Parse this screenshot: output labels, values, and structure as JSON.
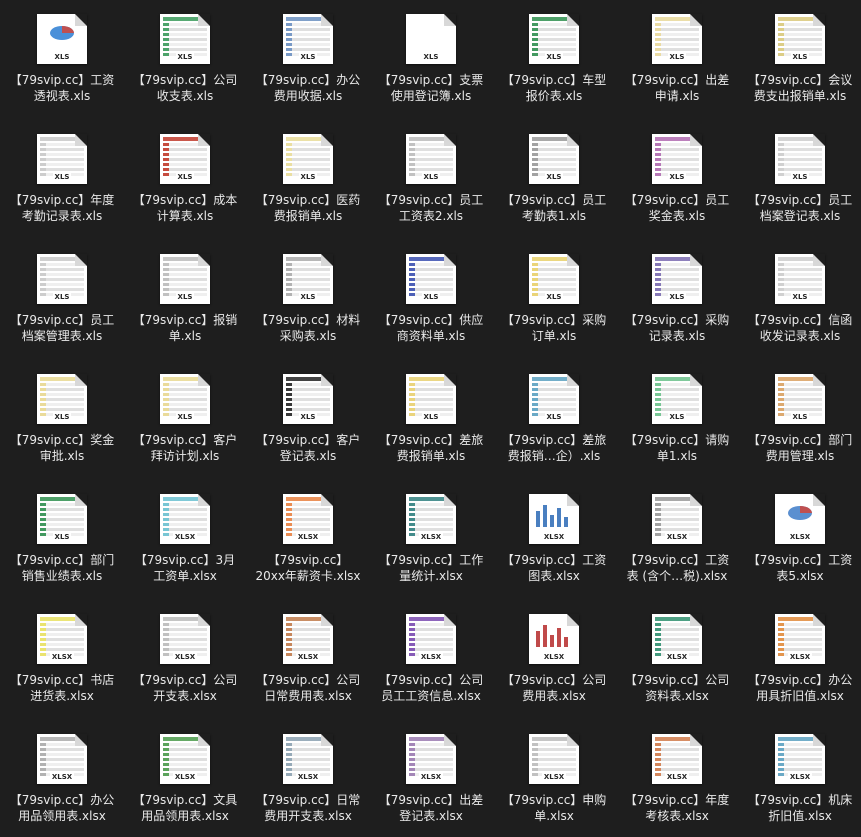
{
  "files": [
    {
      "line1": "【79svip.cc】工资",
      "line2": "透视表.xls",
      "ext": "XLS",
      "icon": "pie-chart-icon",
      "accent": "#4a90d9"
    },
    {
      "line1": "【79svip.cc】公司",
      "line2": "收支表.xls",
      "ext": "XLS",
      "icon": "spreadsheet-icon",
      "accent": "#3a9a5a"
    },
    {
      "line1": "【79svip.cc】办公",
      "line2": "费用收据.xls",
      "ext": "XLS",
      "icon": "spreadsheet-icon",
      "accent": "#6a8fc0"
    },
    {
      "line1": "【79svip.cc】支票",
      "line2": "使用登记簿.xls",
      "ext": "XLS",
      "icon": "blank-document-icon",
      "accent": "#ffffff"
    },
    {
      "line1": "【79svip.cc】车型",
      "line2": "报价表.xls",
      "ext": "XLS",
      "icon": "spreadsheet-icon",
      "accent": "#2f8f4f"
    },
    {
      "line1": "【79svip.cc】出差",
      "line2": "申请.xls",
      "ext": "XLS",
      "icon": "spreadsheet-icon",
      "accent": "#e8d89a"
    },
    {
      "line1": "【79svip.cc】会议",
      "line2": "费支出报销单.xls",
      "ext": "XLS",
      "icon": "spreadsheet-icon",
      "accent": "#d9c87a"
    },
    {
      "line1": "【79svip.cc】年度",
      "line2": "考勤记录表.xls",
      "ext": "XLS",
      "icon": "spreadsheet-icon",
      "accent": "#c8c8c8"
    },
    {
      "line1": "【79svip.cc】成本",
      "line2": "计算表.xls",
      "ext": "XLS",
      "icon": "spreadsheet-icon",
      "accent": "#c0392b"
    },
    {
      "line1": "【79svip.cc】医药",
      "line2": "费报销单.xls",
      "ext": "XLS",
      "icon": "spreadsheet-icon",
      "accent": "#e8dc98"
    },
    {
      "line1": "【79svip.cc】员工",
      "line2": "工资表2.xls",
      "ext": "XLS",
      "icon": "spreadsheet-icon",
      "accent": "#bbbbbb"
    },
    {
      "line1": "【79svip.cc】员工",
      "line2": "考勤表1.xls",
      "ext": "XLS",
      "icon": "spreadsheet-icon",
      "accent": "#999999"
    },
    {
      "line1": "【79svip.cc】员工",
      "line2": "奖金表.xls",
      "ext": "XLS",
      "icon": "spreadsheet-icon",
      "accent": "#b06ab0"
    },
    {
      "line1": "【79svip.cc】员工",
      "line2": "档案登记表.xls",
      "ext": "XLS",
      "icon": "spreadsheet-icon",
      "accent": "#cccccc"
    },
    {
      "line1": "【79svip.cc】员工",
      "line2": "档案管理表.xls",
      "ext": "XLS",
      "icon": "spreadsheet-icon",
      "accent": "#c8c8c8"
    },
    {
      "line1": "【79svip.cc】报销",
      "line2": "单.xls",
      "ext": "XLS",
      "icon": "spreadsheet-icon",
      "accent": "#bbbbbb"
    },
    {
      "line1": "【79svip.cc】材料",
      "line2": "采购表.xls",
      "ext": "XLS",
      "icon": "spreadsheet-icon",
      "accent": "#aaaaaa"
    },
    {
      "line1": "【79svip.cc】供应",
      "line2": "商资料单.xls",
      "ext": "XLS",
      "icon": "spreadsheet-icon",
      "accent": "#3a4fb0"
    },
    {
      "line1": "【79svip.cc】采购",
      "line2": "订单.xls",
      "ext": "XLS",
      "icon": "spreadsheet-icon",
      "accent": "#e8d06a"
    },
    {
      "line1": "【79svip.cc】采购",
      "line2": "记录表.xls",
      "ext": "XLS",
      "icon": "spreadsheet-icon",
      "accent": "#7a6ab0"
    },
    {
      "line1": "【79svip.cc】信函",
      "line2": "收发记录表.xls",
      "ext": "XLS",
      "icon": "spreadsheet-icon",
      "accent": "#cccccc"
    },
    {
      "line1": "【79svip.cc】奖金",
      "line2": "审批.xls",
      "ext": "XLS",
      "icon": "spreadsheet-icon",
      "accent": "#e8d890"
    },
    {
      "line1": "【79svip.cc】客户",
      "line2": "拜访计划.xls",
      "ext": "XLS",
      "icon": "spreadsheet-icon",
      "accent": "#e8d890"
    },
    {
      "line1": "【79svip.cc】客户",
      "line2": "登记表.xls",
      "ext": "XLS",
      "icon": "spreadsheet-icon",
      "accent": "#222222"
    },
    {
      "line1": "【79svip.cc】差旅",
      "line2": "费报销单.xls",
      "ext": "XLS",
      "icon": "spreadsheet-icon",
      "accent": "#e8d070"
    },
    {
      "line1": "【79svip.cc】差旅",
      "line2": "费报销…企）.xls",
      "ext": "XLS",
      "icon": "spreadsheet-icon",
      "accent": "#5aa0c0"
    },
    {
      "line1": "【79svip.cc】请购",
      "line2": "单1.xls",
      "ext": "XLS",
      "icon": "spreadsheet-icon",
      "accent": "#6ac08a"
    },
    {
      "line1": "【79svip.cc】部门",
      "line2": "费用管理.xls",
      "ext": "XLS",
      "icon": "spreadsheet-icon",
      "accent": "#d9a060"
    },
    {
      "line1": "【79svip.cc】部门",
      "line2": "销售业绩表.xls",
      "ext": "XLS",
      "icon": "spreadsheet-icon",
      "accent": "#2f8f4f"
    },
    {
      "line1": "【79svip.cc】3月",
      "line2": "工资单.xlsx",
      "ext": "XLSX",
      "icon": "spreadsheet-icon",
      "accent": "#6ac0d0"
    },
    {
      "line1": "【79svip.cc】",
      "line2": "20xx年薪资卡.xlsx",
      "ext": "XLSX",
      "icon": "spreadsheet-icon",
      "accent": "#e88040"
    },
    {
      "line1": "【79svip.cc】工作",
      "line2": "量统计.xlsx",
      "ext": "XLSX",
      "icon": "spreadsheet-icon",
      "accent": "#2f7f7f"
    },
    {
      "line1": "【79svip.cc】工资",
      "line2": "图表.xlsx",
      "ext": "XLSX",
      "icon": "bar-chart-icon",
      "accent": "#4a7fc0"
    },
    {
      "line1": "【79svip.cc】工资",
      "line2": "表 (含个…税).xlsx",
      "ext": "XLSX",
      "icon": "spreadsheet-icon",
      "accent": "#999999"
    },
    {
      "line1": "【79svip.cc】工资",
      "line2": "表5.xlsx",
      "ext": "XLSX",
      "icon": "pie-chart-icon",
      "accent": "#5a8fd0"
    },
    {
      "line1": "【79svip.cc】书店",
      "line2": "进货表.xlsx",
      "ext": "XLSX",
      "icon": "spreadsheet-icon",
      "accent": "#e8e060"
    },
    {
      "line1": "【79svip.cc】公司",
      "line2": "开支表.xlsx",
      "ext": "XLSX",
      "icon": "spreadsheet-icon",
      "accent": "#bbbbbb"
    },
    {
      "line1": "【79svip.cc】公司",
      "line2": "日常费用表.xlsx",
      "ext": "XLSX",
      "icon": "spreadsheet-icon",
      "accent": "#c07a4a"
    },
    {
      "line1": "【79svip.cc】公司",
      "line2": "员工工资信息.xlsx",
      "ext": "XLSX",
      "icon": "spreadsheet-icon",
      "accent": "#7a4ab0"
    },
    {
      "line1": "【79svip.cc】公司",
      "line2": "费用表.xlsx",
      "ext": "XLSX",
      "icon": "bar-chart-icon",
      "accent": "#c04a4a"
    },
    {
      "line1": "【79svip.cc】公司",
      "line2": "资料表.xlsx",
      "ext": "XLSX",
      "icon": "spreadsheet-icon",
      "accent": "#2f8f6f"
    },
    {
      "line1": "【79svip.cc】办公",
      "line2": "用具折旧值.xlsx",
      "ext": "XLSX",
      "icon": "spreadsheet-icon",
      "accent": "#e08a3a"
    },
    {
      "line1": "【79svip.cc】办公",
      "line2": "用品领用表.xlsx",
      "ext": "XLSX",
      "icon": "spreadsheet-icon",
      "accent": "#aaaaaa"
    },
    {
      "line1": "【79svip.cc】文具",
      "line2": "用品领用表.xlsx",
      "ext": "XLSX",
      "icon": "spreadsheet-icon",
      "accent": "#4a9a4a"
    },
    {
      "line1": "【79svip.cc】日常",
      "line2": "费用开支表.xlsx",
      "ext": "XLSX",
      "icon": "spreadsheet-icon",
      "accent": "#8aa0b0"
    },
    {
      "line1": "【79svip.cc】出差",
      "line2": "登记表.xlsx",
      "ext": "XLSX",
      "icon": "spreadsheet-icon",
      "accent": "#9a7ab0"
    },
    {
      "line1": "【79svip.cc】申购",
      "line2": "单.xlsx",
      "ext": "XLSX",
      "icon": "spreadsheet-icon",
      "accent": "#bbbbbb"
    },
    {
      "line1": "【79svip.cc】年度",
      "line2": "考核表.xlsx",
      "ext": "XLSX",
      "icon": "spreadsheet-icon",
      "accent": "#d07a4a"
    },
    {
      "line1": "【79svip.cc】机床",
      "line2": "折旧值.xlsx",
      "ext": "XLSX",
      "icon": "spreadsheet-icon",
      "accent": "#5aa0c0"
    }
  ]
}
